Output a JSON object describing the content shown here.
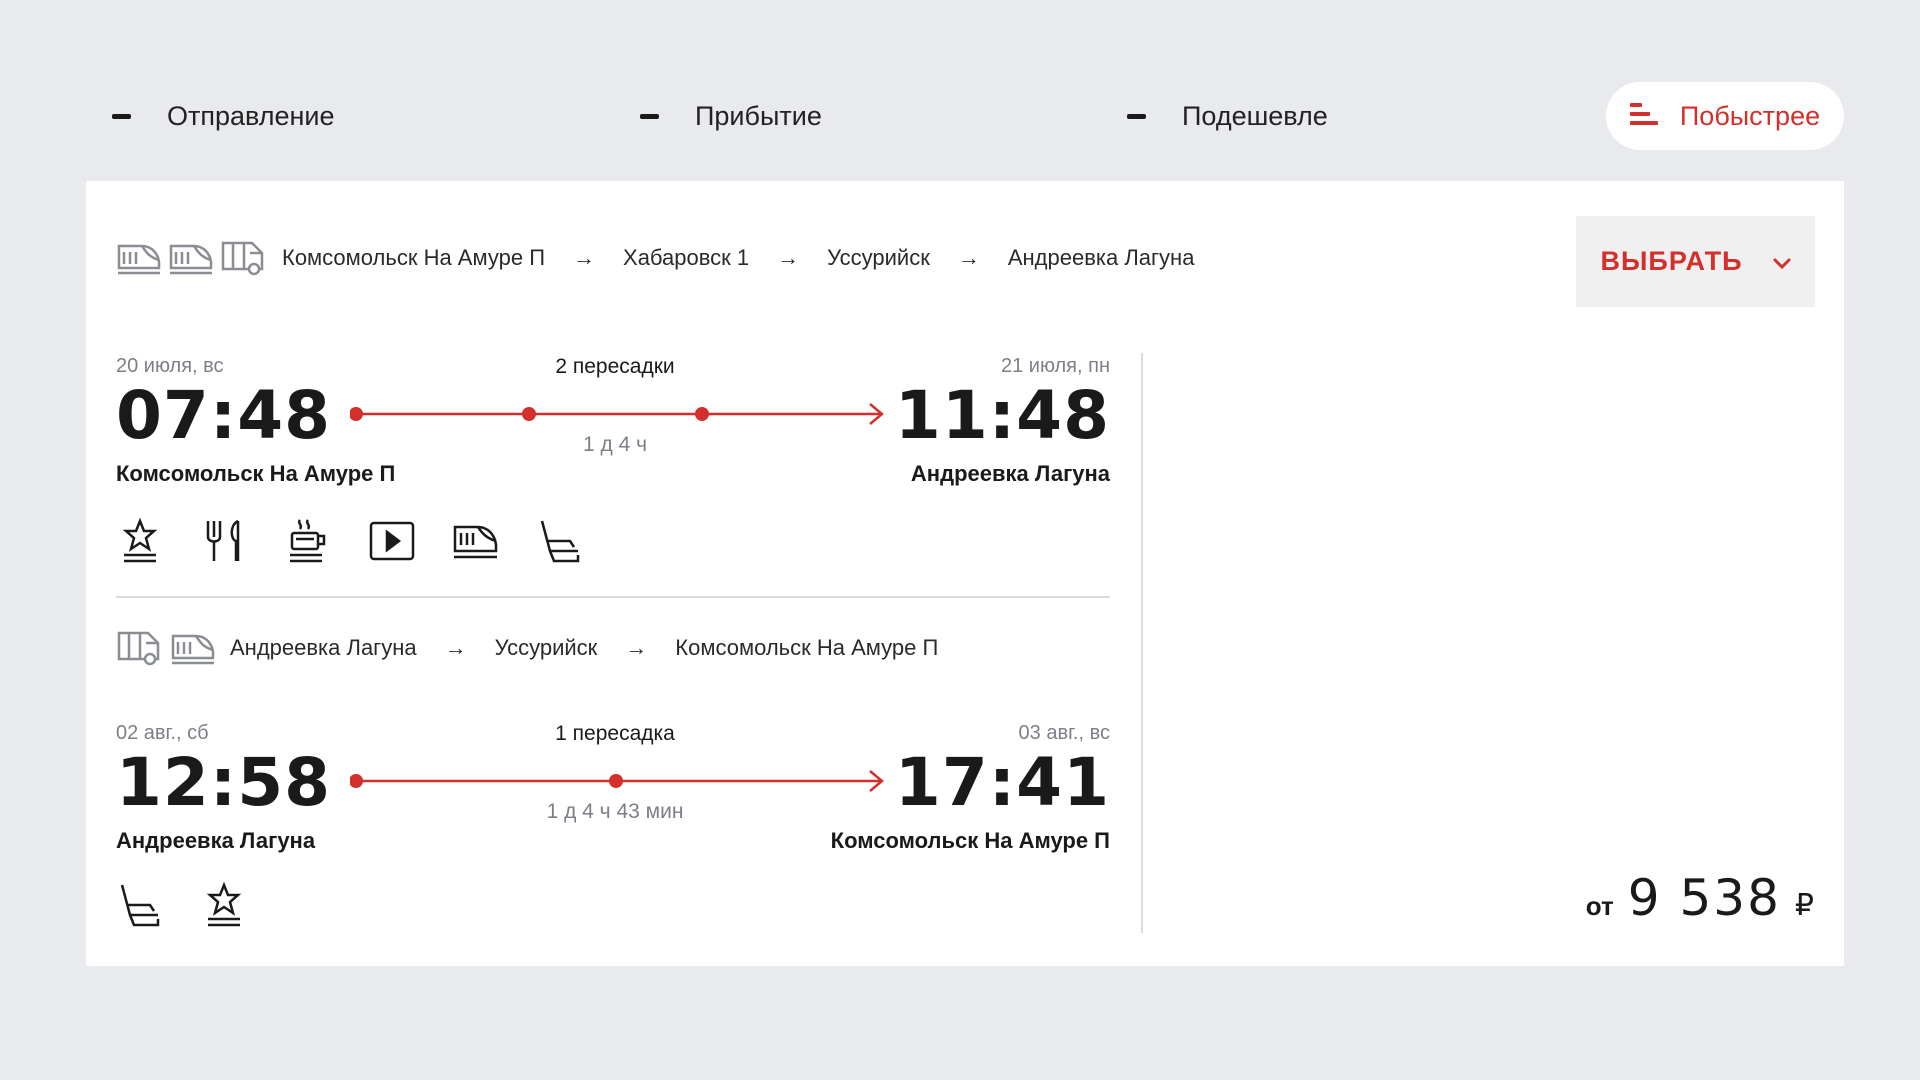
{
  "sort": {
    "departure": "Отправление",
    "arrival": "Прибытие",
    "cheaper": "Подешевле",
    "faster": "Побыстрее"
  },
  "colors": {
    "accent": "#d3302b",
    "background": "#e9eaed",
    "card": "#ffffff"
  },
  "card": {
    "choose_label": "ВЫБРАТЬ",
    "price_prefix": "от",
    "price_amount": "9 538",
    "currency": "₽",
    "outbound": {
      "route": [
        "Комсомольск На Амуре П",
        "Хабаровск 1",
        "Уссурийск",
        "Андреевка Лагуна"
      ],
      "transport_icons": [
        "high-speed-train-icon",
        "high-speed-train-icon",
        "bus-icon"
      ],
      "dep_date": "20 июля, вс",
      "dep_time": "07:48",
      "dep_station": "Комсомольск На Амуре П",
      "transfers": "2 пересадки",
      "duration": "1 д 4 ч",
      "arr_date": "21 июля, пн",
      "arr_time": "11:48",
      "arr_station": "Андреевка Лагуна",
      "amenities": [
        "star-class-icon",
        "restaurant-icon",
        "coffee-icon",
        "video-icon",
        "train-icon",
        "seat-icon"
      ]
    },
    "return": {
      "route": [
        "Андреевка Лагуна",
        "Уссурийск",
        "Комсомольск На Амуре П"
      ],
      "transport_icons": [
        "bus-icon",
        "high-speed-train-icon"
      ],
      "dep_date": "02 авг., сб",
      "dep_time": "12:58",
      "dep_station": "Андреевка Лагуна",
      "transfers": "1 пересадка",
      "duration": "1 д 4 ч 43 мин",
      "arr_date": "03 авг., вс",
      "arr_time": "17:41",
      "arr_station": "Комсомольск На Амуре П",
      "amenities": [
        "seat-icon",
        "star-class-icon"
      ]
    }
  }
}
